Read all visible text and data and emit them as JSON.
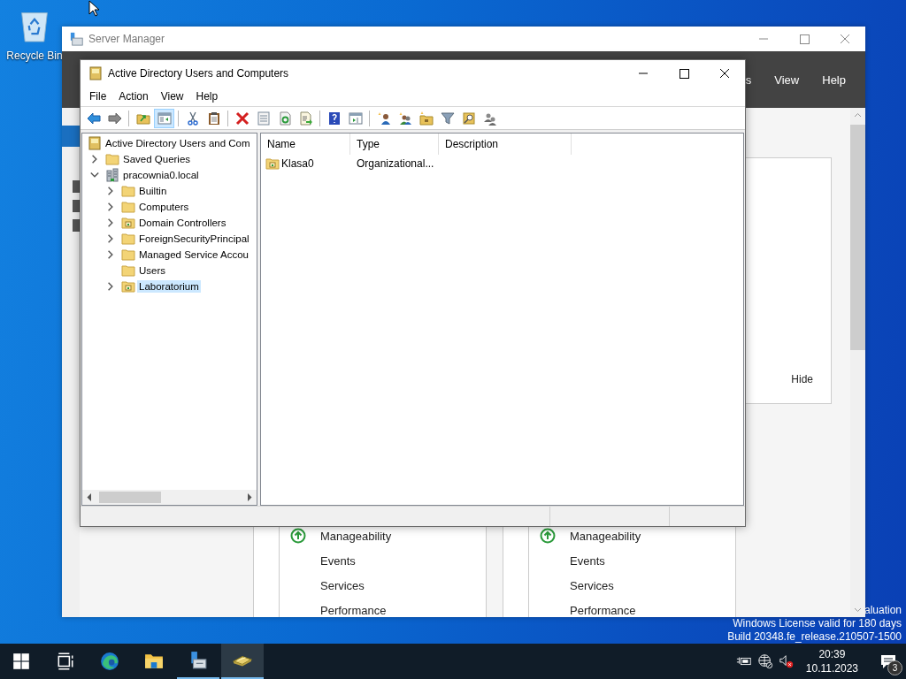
{
  "desktop": {
    "icons": [
      {
        "label": "Recycle Bin"
      }
    ],
    "license_notice": [
      "aluation",
      "Windows License valid for 180 days",
      "Build 20348.fe_release.210507-1500"
    ]
  },
  "server_manager": {
    "title": "Server Manager",
    "header_menu": [
      "s",
      "View",
      "Help"
    ],
    "panel_button": "Hide",
    "cards": [
      {
        "kind": "up",
        "status_label": "Manageability",
        "items": [
          "Events",
          "Services",
          "Performance"
        ]
      },
      {
        "kind": "up",
        "status_label": "Manageability",
        "items": [
          "Events",
          "Services",
          "Performance"
        ]
      }
    ]
  },
  "aduc": {
    "title": "Active Directory Users and Computers",
    "menu": [
      "File",
      "Action",
      "View",
      "Help"
    ],
    "toolbar": [
      [
        {
          "kind": "back",
          "on": false
        },
        {
          "kind": "forward",
          "on": false
        }
      ],
      [
        {
          "kind": "up",
          "on": false
        },
        {
          "kind": "tree",
          "on": true
        }
      ],
      [
        {
          "kind": "cut",
          "on": false
        },
        {
          "kind": "paste",
          "on": false
        }
      ],
      [
        {
          "kind": "delete",
          "on": false
        },
        {
          "kind": "properties",
          "on": false
        },
        {
          "kind": "refresh",
          "on": false
        },
        {
          "kind": "export",
          "on": false
        }
      ],
      [
        {
          "kind": "help",
          "on": false
        },
        {
          "kind": "pane",
          "on": false
        }
      ],
      [
        {
          "kind": "new-user",
          "on": false
        },
        {
          "kind": "new-group",
          "on": false
        },
        {
          "kind": "new-ou",
          "on": false
        },
        {
          "kind": "filter",
          "on": false
        },
        {
          "kind": "find",
          "on": false
        },
        {
          "kind": "add-group",
          "on": false
        }
      ]
    ],
    "tree": [
      {
        "label": "Active Directory Users and Com",
        "kind": "root",
        "selected": false,
        "children": [
          {
            "label": "Saved Queries",
            "kind": "folder",
            "expandable": true,
            "expanded": false,
            "selected": false
          },
          {
            "label": "pracownia0.local",
            "kind": "domain",
            "expandable": true,
            "expanded": true,
            "selected": false,
            "children": [
              {
                "label": "Builtin",
                "kind": "folder",
                "expandable": true,
                "expanded": false,
                "selected": false
              },
              {
                "label": "Computers",
                "kind": "folder",
                "expandable": true,
                "expanded": false,
                "selected": false
              },
              {
                "label": "Domain Controllers",
                "kind": "ou",
                "expandable": true,
                "expanded": false,
                "selected": false
              },
              {
                "label": "ForeignSecurityPrincipal",
                "kind": "folder",
                "expandable": true,
                "expanded": false,
                "selected": false
              },
              {
                "label": "Managed Service Accou",
                "kind": "folder",
                "expandable": true,
                "expanded": false,
                "selected": false
              },
              {
                "label": "Users",
                "kind": "folder",
                "expandable": false,
                "selected": false
              },
              {
                "label": "Laboratorium",
                "kind": "ou",
                "expandable": true,
                "expanded": false,
                "selected": true
              }
            ]
          }
        ]
      }
    ],
    "list": {
      "columns": [
        "Name",
        "Type",
        "Description"
      ],
      "rows": [
        {
          "kind": "ou",
          "cells": [
            "Klasa0",
            "Organizational..."
          ]
        }
      ]
    }
  },
  "taskbar": {
    "items": [
      {
        "kind": "start",
        "running": false,
        "active": false
      },
      {
        "kind": "task-view",
        "running": false,
        "active": false
      },
      {
        "kind": "edge",
        "running": false,
        "active": false
      },
      {
        "kind": "explorer",
        "running": false,
        "active": false
      },
      {
        "kind": "server-manager",
        "running": true,
        "active": false
      },
      {
        "kind": "aduc",
        "running": true,
        "active": true
      }
    ],
    "tray": {
      "time": "20:39",
      "date": "10.11.2023",
      "notifications": "3"
    }
  }
}
